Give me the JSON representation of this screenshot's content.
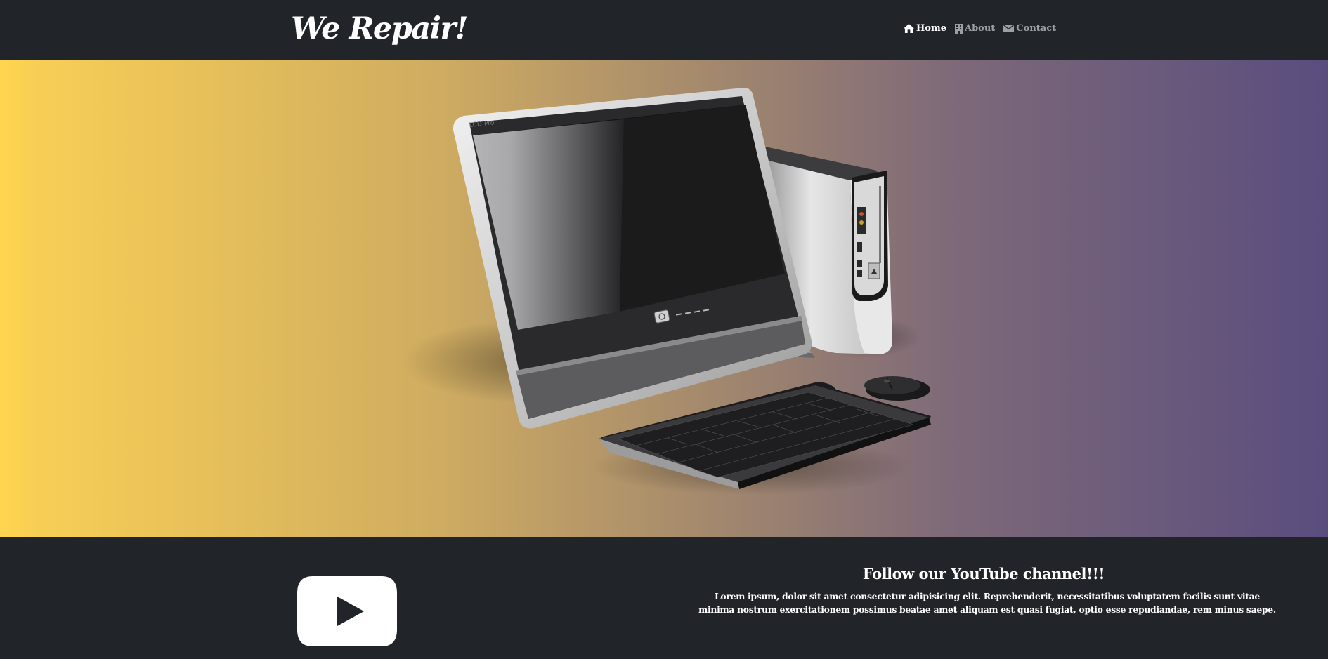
{
  "brand": {
    "title": "We Repair!"
  },
  "nav": {
    "items": [
      {
        "label": "Home",
        "icon": "home-icon",
        "active": true
      },
      {
        "label": "About",
        "icon": "building-icon",
        "active": false
      },
      {
        "label": "Contact",
        "icon": "envelope-icon",
        "active": false
      }
    ]
  },
  "hero": {
    "image": "desktop-computer-illustration",
    "gradient": [
      "#ffd54f",
      "#cfac61",
      "#a0866e",
      "#5a4d7e"
    ]
  },
  "youtube": {
    "icon": "youtube-play-icon",
    "title": "Follow our YouTube channel!!!",
    "text": "Lorem ipsum, dolor sit amet consectetur adipisicing elit. Reprehenderit, necessitatibus voluptatem facilis sunt vitae minima nostrum exercitationem possimus beatae amet aliquam est quasi fugiat, optio esse repudiandae, rem minus saepe."
  },
  "colors": {
    "navbar_bg": "#212529",
    "nav_active": "#ffffff",
    "nav_inactive": "#9aa0a6"
  }
}
